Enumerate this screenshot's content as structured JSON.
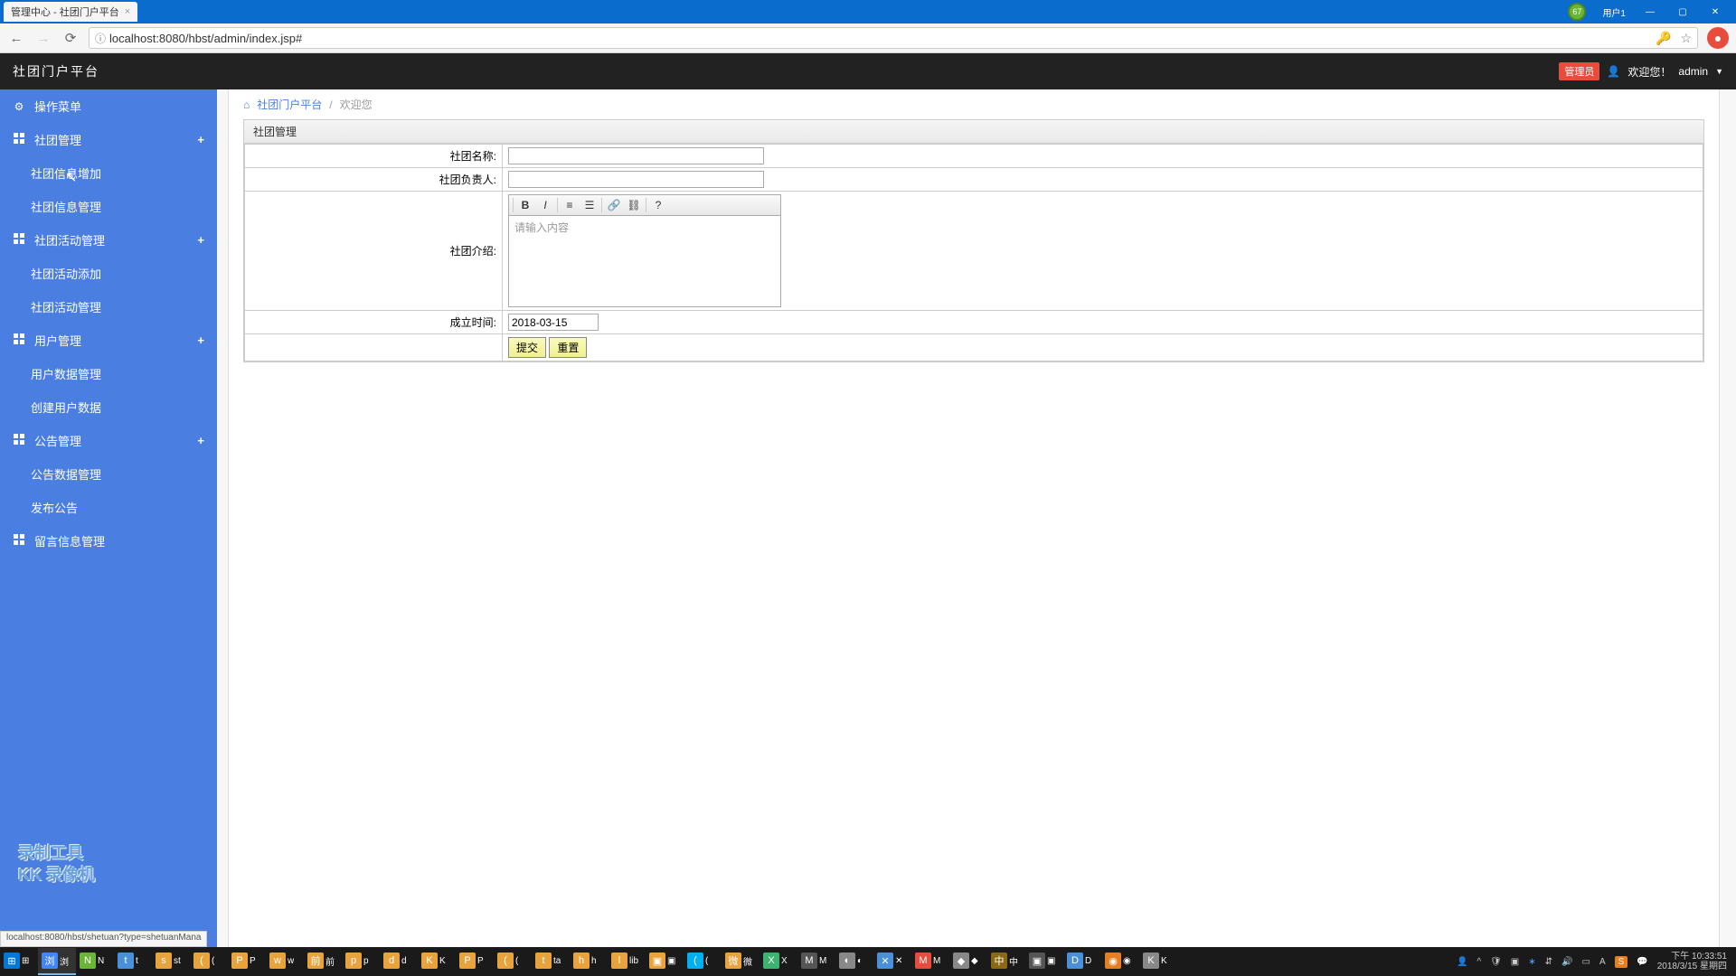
{
  "browser": {
    "tab_title": "管理中心 - 社团门户平台",
    "user_label": "用户1",
    "badge": "67",
    "url": "localhost:8080/hbst/admin/index.jsp#"
  },
  "header": {
    "brand": "社团门户平台",
    "admin_badge": "管理员",
    "welcome": "欢迎您！",
    "username": "admin"
  },
  "sidebar": {
    "menu_title": "操作菜单",
    "groups": [
      {
        "label": "社团管理",
        "items": [
          "社团信息增加",
          "社团信息管理"
        ]
      },
      {
        "label": "社团活动管理",
        "items": [
          "社团活动添加",
          "社团活动管理"
        ]
      },
      {
        "label": "用户管理",
        "items": [
          "用户数据管理",
          "创建用户数据"
        ]
      },
      {
        "label": "公告管理",
        "items": [
          "公告数据管理",
          "发布公告"
        ]
      },
      {
        "label": "留言信息管理",
        "items": []
      }
    ]
  },
  "breadcrumb": {
    "home": "社团门户平台",
    "current": "欢迎您"
  },
  "panel": {
    "title": "社团管理",
    "fields": {
      "name_label": "社团名称:",
      "leader_label": "社团负责人:",
      "intro_label": "社团介绍:",
      "date_label": "成立时间:",
      "date_value": "2018-03-15",
      "editor_placeholder": "请输入内容",
      "submit": "提交",
      "reset": "重置"
    }
  },
  "status_url": "localhost:8080/hbst/shetuan?type=shetuanMana",
  "watermark": {
    "l1": "录制工具",
    "l2": "KK 录像机"
  },
  "taskbar": {
    "items": [
      "⊞",
      "浏",
      "N",
      "t",
      "st",
      "(",
      "P",
      "w",
      "前",
      "p",
      "d",
      "K",
      "P",
      "(",
      "ta",
      "h",
      "lib",
      "▣",
      "(",
      "微",
      "X",
      "M",
      "◐",
      "✕",
      "M",
      "◆",
      "中",
      "▣",
      "D",
      "◉",
      "K"
    ],
    "clock_time": "下午 10:33:51",
    "clock_date": "2018/3/15 星期四"
  }
}
